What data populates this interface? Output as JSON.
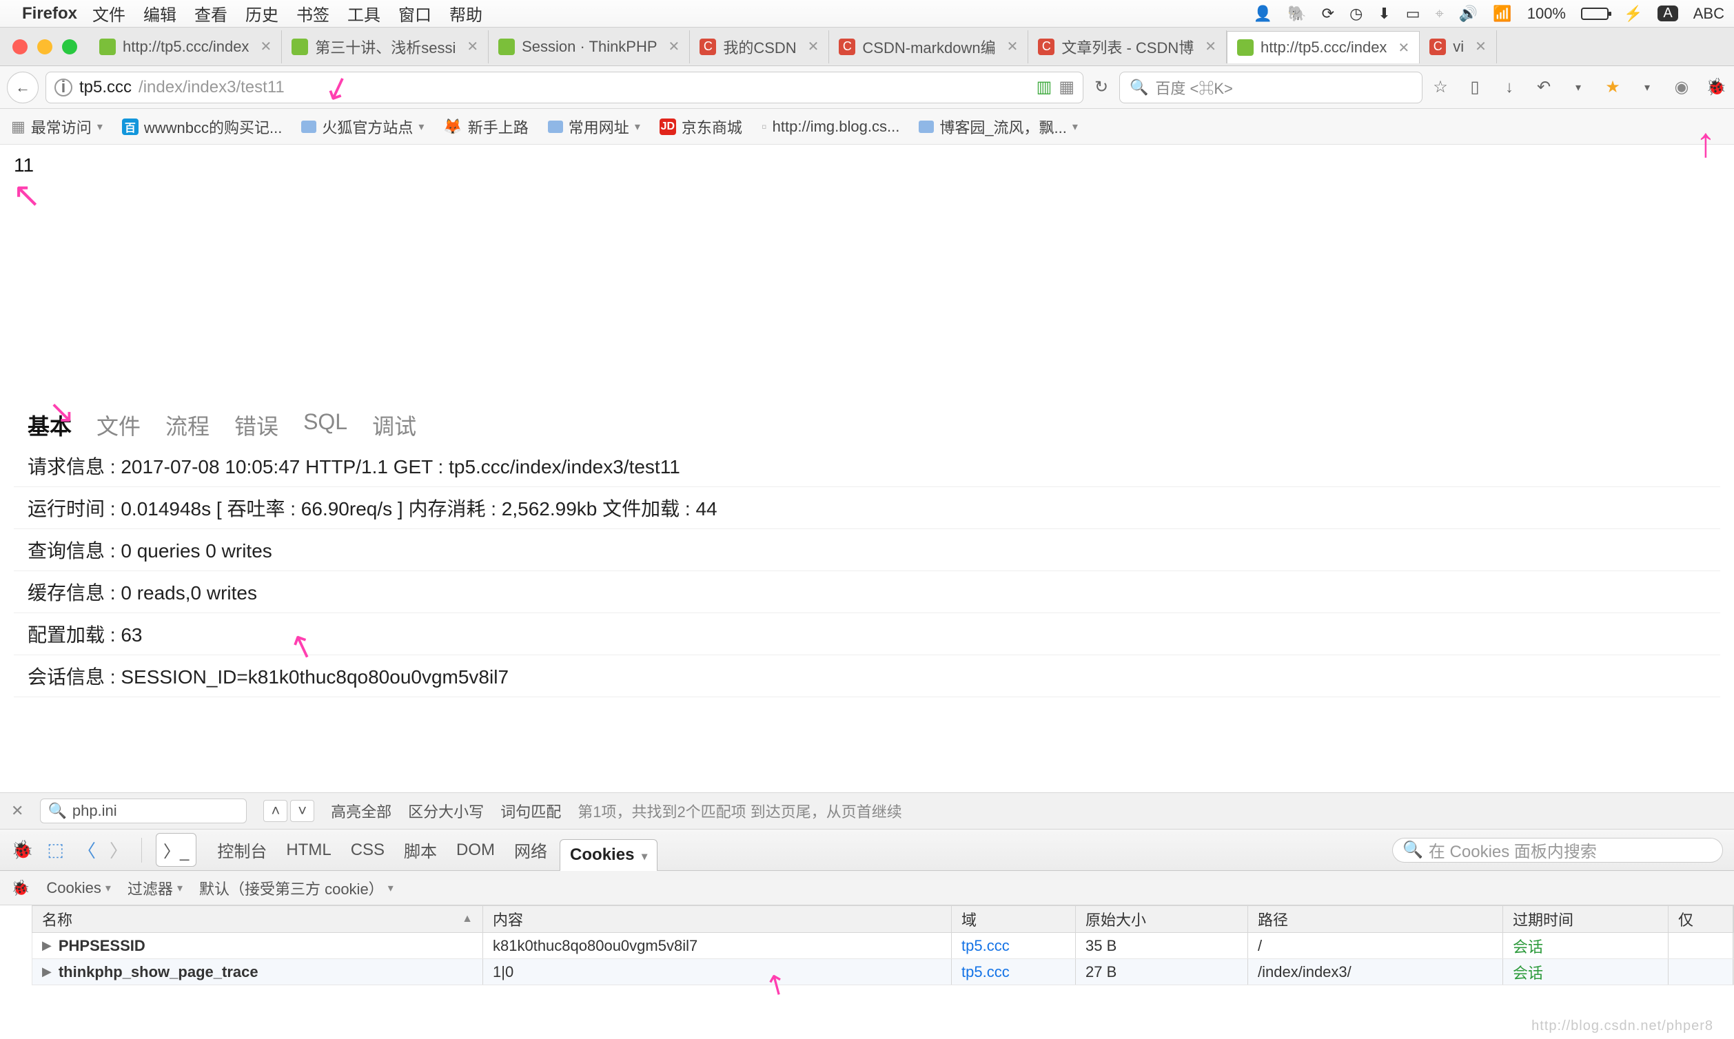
{
  "mac_menu": {
    "app": "Firefox",
    "items": [
      "文件",
      "编辑",
      "查看",
      "历史",
      "书签",
      "工具",
      "窗口",
      "帮助"
    ],
    "right": {
      "battery": "100%",
      "charge_icon": "⚡",
      "input": "ABC",
      "input_badge": "A"
    }
  },
  "tabs": [
    {
      "title": "http://tp5.ccc/index",
      "fav_bg": "#7bbf3a",
      "fav_txt": ""
    },
    {
      "title": "第三十讲、浅析sessi",
      "fav_bg": "#7bbf3a",
      "fav_txt": ""
    },
    {
      "title": "Session · ThinkPHP",
      "fav_bg": "#7bbf3a",
      "fav_txt": ""
    },
    {
      "title": "我的CSDN",
      "fav_bg": "#d94b3a",
      "fav_txt": "C"
    },
    {
      "title": "CSDN-markdown编",
      "fav_bg": "#d94b3a",
      "fav_txt": "C"
    },
    {
      "title": "文章列表 - CSDN博",
      "fav_bg": "#d94b3a",
      "fav_txt": "C"
    },
    {
      "title": "http://tp5.ccc/index",
      "fav_bg": "#7bbf3a",
      "fav_txt": "",
      "active": true
    },
    {
      "title": "vi",
      "fav_bg": "#d94b3a",
      "fav_txt": "C"
    }
  ],
  "address": {
    "host": "tp5.ccc",
    "path": "/index/index3/test11"
  },
  "search": {
    "placeholder": "百度 <⌘K>"
  },
  "bookmarks": [
    {
      "label": "最常访问",
      "icon": "grid",
      "chev": true
    },
    {
      "label": "wwwnbcc的购买记...",
      "icon": "sq",
      "bg": "#1296db",
      "txt": "百"
    },
    {
      "label": "火狐官方站点",
      "icon": "fold",
      "chev": true
    },
    {
      "label": "新手上路",
      "icon": "ff"
    },
    {
      "label": "常用网址",
      "icon": "fold",
      "chev": true
    },
    {
      "label": "京东商城",
      "icon": "sq",
      "bg": "#e1251b",
      "txt": "JD"
    },
    {
      "label": "http://img.blog.cs...",
      "icon": "blank"
    },
    {
      "label": "博客园_流风，飘...",
      "icon": "fold",
      "chev": true
    }
  ],
  "page_output": "11",
  "debug_tabs": [
    "基本",
    "文件",
    "流程",
    "错误",
    "SQL",
    "调试"
  ],
  "debug_active": 0,
  "debug_rows": [
    "请求信息 : 2017-07-08 10:05:47 HTTP/1.1 GET : tp5.ccc/index/index3/test11",
    "运行时间 : 0.014948s [ 吞吐率 : 66.90req/s ] 内存消耗 : 2,562.99kb 文件加载 : 44",
    "查询信息 : 0 queries 0 writes",
    "缓存信息 : 0 reads,0 writes",
    "配置加载 : 63",
    "会话信息 : SESSION_ID=k81k0thuc8qo80ou0vgm5v8il7"
  ],
  "find": {
    "value": "php.ini",
    "highlight": "高亮全部",
    "case": "区分大小写",
    "whole": "词句匹配",
    "status": "第1项，共找到2个匹配项    到达页尾，从页首继续"
  },
  "dev_tabs": [
    "控制台",
    "HTML",
    "CSS",
    "脚本",
    "DOM",
    "网络",
    "Cookies"
  ],
  "dev_active": 6,
  "dev_search_placeholder": "在 Cookies 面板内搜索",
  "cookies_toolbar": {
    "menu": "Cookies",
    "filter": "过滤器",
    "default": "默认（接受第三方 cookie）"
  },
  "cookies_table": {
    "headers": {
      "name": "名称",
      "value": "内容",
      "domain": "域",
      "size": "原始大小",
      "path": "路径",
      "expires": "过期时间",
      "more": "仅"
    },
    "rows": [
      {
        "name": "PHPSESSID",
        "value": "k81k0thuc8qo80ou0vgm5v8il7",
        "domain": "tp5.ccc",
        "size": "35 B",
        "path": "/",
        "expires": "会话"
      },
      {
        "name": "thinkphp_show_page_trace",
        "value": "1|0",
        "domain": "tp5.ccc",
        "size": "27 B",
        "path": "/index/index3/",
        "expires": "会话"
      }
    ]
  },
  "watermark": "http://blog.csdn.net/phper8"
}
